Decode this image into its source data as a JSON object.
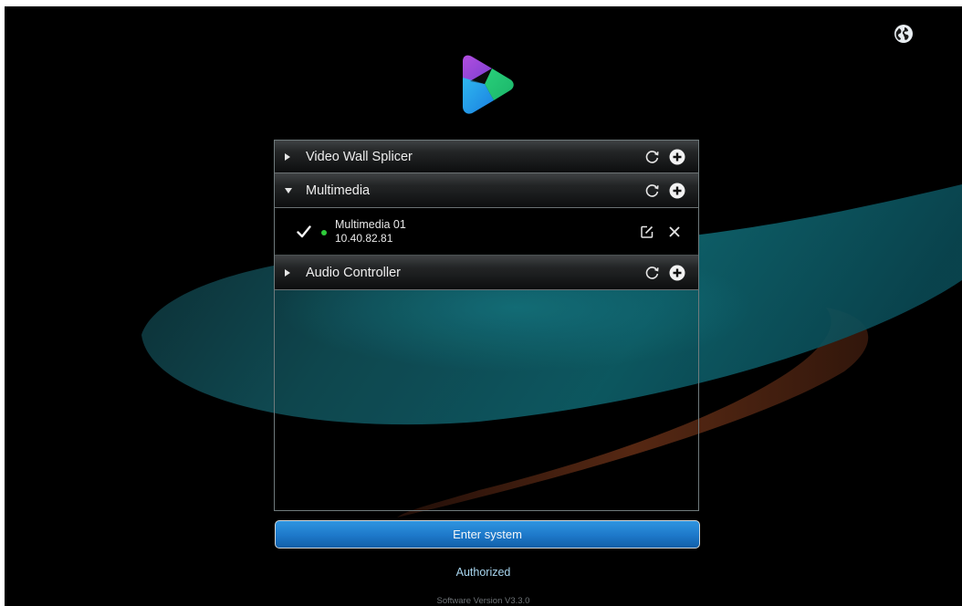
{
  "icons": {
    "language": "globe-icon",
    "logo": "app-logo",
    "expand": "caret-right-icon",
    "collapse": "caret-down-icon",
    "refresh": "refresh-icon",
    "add": "plus-circle-icon",
    "selected": "checkmark-icon",
    "online": "online-status-dot",
    "edit": "edit-icon",
    "delete": "close-icon"
  },
  "colors": {
    "background": "#000000",
    "accent_button": "#1d78c9",
    "online_status": "#2ecb3a",
    "authorized_text": "#a8d6ef"
  },
  "groups": [
    {
      "title": "Video Wall Splicer",
      "expanded": false
    },
    {
      "title": "Multimedia",
      "expanded": true,
      "devices": [
        {
          "name": "Multimedia 01",
          "ip": "10.40.82.81",
          "selected": true,
          "online": true
        }
      ]
    },
    {
      "title": "Audio Controller",
      "expanded": false
    }
  ],
  "enter_button": {
    "label": "Enter system"
  },
  "authorized_label": "Authorized",
  "version_label": "Software Version V3.3.0"
}
